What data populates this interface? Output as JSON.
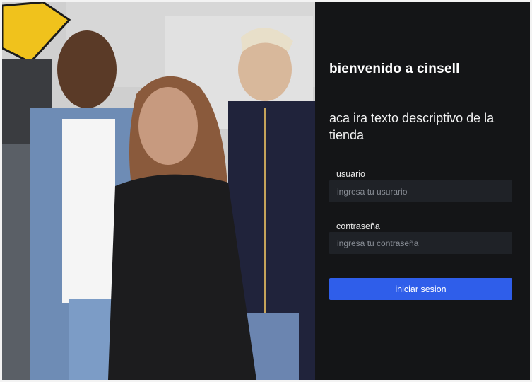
{
  "login": {
    "title": "bienvenido a cinsell",
    "subtitle": "aca ira texto descriptivo de la tienda",
    "username_label": "usuario",
    "username_placeholder": "ingresa tu usurario",
    "password_label": "contraseña",
    "password_placeholder": "ingresa tu contraseña",
    "submit_label": "iniciar sesion"
  },
  "theme": {
    "panel_bg": "#141517",
    "input_bg": "#1f2227",
    "button_bg": "#2f5eea",
    "text_color": "#ffffff"
  }
}
